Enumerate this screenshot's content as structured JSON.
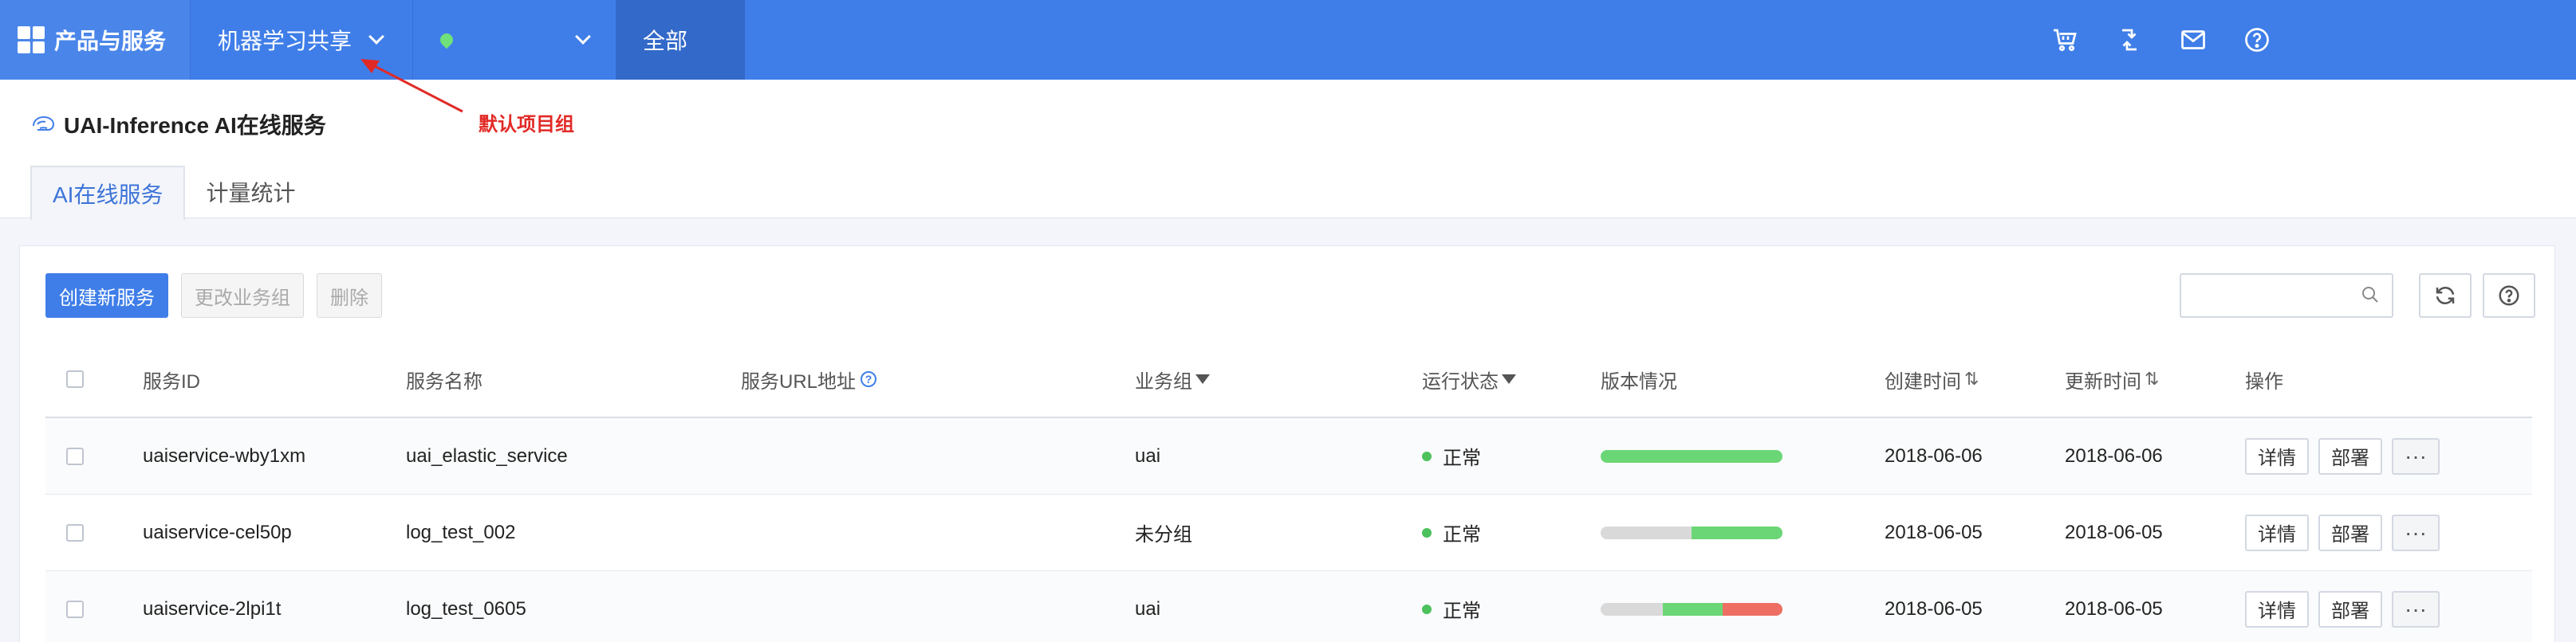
{
  "topbar": {
    "products_label": "产品与服务",
    "project_label": "机器学习共享",
    "region_label": "",
    "all_label": "全部",
    "icons": [
      "cart-icon",
      "transfer-icon",
      "mail-icon",
      "help-icon"
    ]
  },
  "annotation": {
    "text": "默认项目组",
    "color": "#e12a26"
  },
  "page": {
    "title": "UAI-Inference AI在线服务",
    "tabs": [
      {
        "label": "AI在线服务"
      },
      {
        "label": "计量统计"
      }
    ]
  },
  "toolbar": {
    "create_label": "创建新服务",
    "change_group_label": "更改业务组",
    "delete_label": "删除",
    "search_placeholder": ""
  },
  "table": {
    "headers": {
      "service_id": "服务ID",
      "service_name": "服务名称",
      "url": "服务URL地址",
      "group": "业务组",
      "status": "运行状态",
      "version": "版本情况",
      "created": "创建时间",
      "updated": "更新时间",
      "ops": "操作"
    },
    "rows": [
      {
        "id": "uaiservice-wby1xm",
        "name": "uai_elastic_service",
        "url": "",
        "group": "uai",
        "status": "正常",
        "version": [
          {
            "fraction": 1.0,
            "color": "#6bd676"
          }
        ],
        "created": "2018-06-06",
        "updated": "2018-06-06",
        "detail": "详情",
        "deploy": "部署",
        "more": "···"
      },
      {
        "id": "uaiservice-cel50p",
        "name": "log_test_002",
        "url": "",
        "group": "未分组",
        "status": "正常",
        "version": [
          {
            "fraction": 0.5,
            "color": "#d9d9d9"
          },
          {
            "fraction": 0.5,
            "color": "#6bd676"
          }
        ],
        "created": "2018-06-05",
        "updated": "2018-06-05",
        "detail": "详情",
        "deploy": "部署",
        "more": "···"
      },
      {
        "id": "uaiservice-2lpi1t",
        "name": "log_test_0605",
        "url": "",
        "group": "uai",
        "status": "正常",
        "version": [
          {
            "fraction": 0.34,
            "color": "#d9d9d9"
          },
          {
            "fraction": 0.33,
            "color": "#6bd676"
          },
          {
            "fraction": 0.33,
            "color": "#ee6e63"
          }
        ],
        "created": "2018-06-05",
        "updated": "2018-06-05",
        "detail": "详情",
        "deploy": "部署",
        "more": "···"
      }
    ]
  }
}
